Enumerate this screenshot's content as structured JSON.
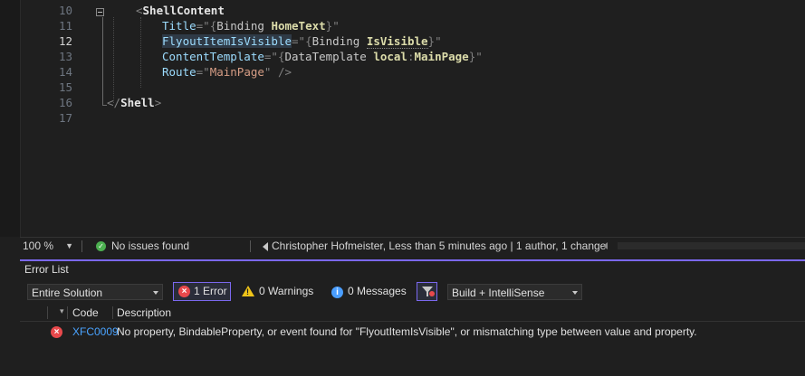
{
  "editor": {
    "lines": [
      {
        "num": "10",
        "active": false,
        "segments": [
          {
            "c": "t-punct",
            "t": "<"
          },
          {
            "c": "t-tag",
            "t": "ShellContent"
          }
        ]
      },
      {
        "num": "11",
        "active": false,
        "segments": [
          {
            "c": "t-attr",
            "t": "Title"
          },
          {
            "c": "t-punct",
            "t": "=\""
          },
          {
            "c": "t-punct",
            "t": "{"
          },
          {
            "c": "t-ext",
            "t": "Binding "
          },
          {
            "c": "t-bold",
            "t": "HomeText"
          },
          {
            "c": "t-punct",
            "t": "}"
          },
          {
            "c": "t-punct",
            "t": "\""
          }
        ]
      },
      {
        "num": "12",
        "active": true,
        "segments": [
          {
            "c": "t-attr hl",
            "t": "FlyoutItemIsVisible"
          },
          {
            "c": "t-punct",
            "t": "=\""
          },
          {
            "c": "t-punct",
            "t": "{"
          },
          {
            "c": "t-ext",
            "t": "Binding "
          },
          {
            "c": "t-bold t-under",
            "t": "IsVisible"
          },
          {
            "c": "t-punct",
            "t": "}"
          },
          {
            "c": "t-punct",
            "t": "\""
          }
        ]
      },
      {
        "num": "13",
        "active": false,
        "segments": [
          {
            "c": "t-attr",
            "t": "ContentTemplate"
          },
          {
            "c": "t-punct",
            "t": "=\""
          },
          {
            "c": "t-punct",
            "t": "{"
          },
          {
            "c": "t-ext",
            "t": "DataTemplate "
          },
          {
            "c": "t-bold",
            "t": "local"
          },
          {
            "c": "t-punct",
            "t": ":"
          },
          {
            "c": "t-bold",
            "t": "MainPage"
          },
          {
            "c": "t-punct",
            "t": "}"
          },
          {
            "c": "t-punct",
            "t": "\""
          }
        ]
      },
      {
        "num": "14",
        "active": false,
        "segments": [
          {
            "c": "t-attr",
            "t": "Route"
          },
          {
            "c": "t-punct",
            "t": "=\""
          },
          {
            "c": "t-str",
            "t": "MainPage"
          },
          {
            "c": "t-punct",
            "t": "\" />"
          }
        ]
      },
      {
        "num": "15",
        "active": false,
        "segments": []
      },
      {
        "num": "16",
        "active": false,
        "segments": [
          {
            "c": "t-punct",
            "t": "</"
          },
          {
            "c": "t-tag",
            "t": "Shell"
          },
          {
            "c": "t-punct",
            "t": ">"
          }
        ]
      },
      {
        "num": "17",
        "active": false,
        "segments": []
      }
    ]
  },
  "status": {
    "zoom": "100 %",
    "issues": "No issues found",
    "codelens": "Christopher Hofmeister, Less than 5 minutes ago | 1 author, 1 change"
  },
  "error_list": {
    "title": "Error List",
    "scope": "Entire Solution",
    "errors_label": "1 Error",
    "warnings_label": "0 Warnings",
    "messages_label": "0 Messages",
    "build_filter": "Build + IntelliSense",
    "columns": {
      "code": "Code",
      "description": "Description"
    },
    "rows": [
      {
        "code": "XFC0009",
        "description": "No property, BindableProperty, or event found for \"FlyoutItemIsVisible\", or mismatching type between value and property."
      }
    ]
  },
  "colors": {
    "accent": "#7b68ee",
    "error": "#e8494c",
    "warning": "#f0c419",
    "info": "#4a9eff",
    "link": "#4aa3ff"
  }
}
